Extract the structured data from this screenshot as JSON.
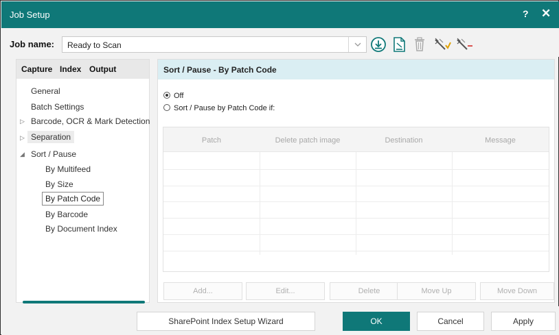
{
  "window": {
    "title": "Job Setup",
    "help": "?",
    "close": "✕"
  },
  "job": {
    "label": "Job name:",
    "value": "Ready to Scan",
    "toolbar": [
      "download-icon",
      "document-icon",
      "trash-icon",
      "wand-add-icon",
      "wand-remove-icon"
    ]
  },
  "tabs": [
    "Capture",
    "Index",
    "Output"
  ],
  "tree": {
    "general": "General",
    "batch_settings": "Batch Settings",
    "barcode_ocr": "Barcode, OCR & Mark Detection",
    "separation": "Separation",
    "sort_pause": "Sort / Pause",
    "by_multifeed": "By Multifeed",
    "by_size": "By Size",
    "by_patch_code": "By Patch Code",
    "by_barcode": "By Barcode",
    "by_document_index": "By Document Index"
  },
  "panel": {
    "header": "Sort / Pause - By Patch Code",
    "option_off": "Off",
    "option_patch": "Sort / Pause by Patch Code if:",
    "selected": "Off",
    "columns": [
      "Patch",
      "Delete patch image",
      "Destination",
      "Message"
    ],
    "buttons": {
      "add": "Add...",
      "edit": "Edit...",
      "delete": "Delete",
      "move_up": "Move Up",
      "move_down": "Move Down"
    }
  },
  "footer": {
    "wizard": "SharePoint Index Setup Wizard",
    "ok": "OK",
    "cancel": "Cancel",
    "apply": "Apply"
  },
  "colors": {
    "accent": "#0f7878",
    "header_bg": "#daeef3"
  }
}
